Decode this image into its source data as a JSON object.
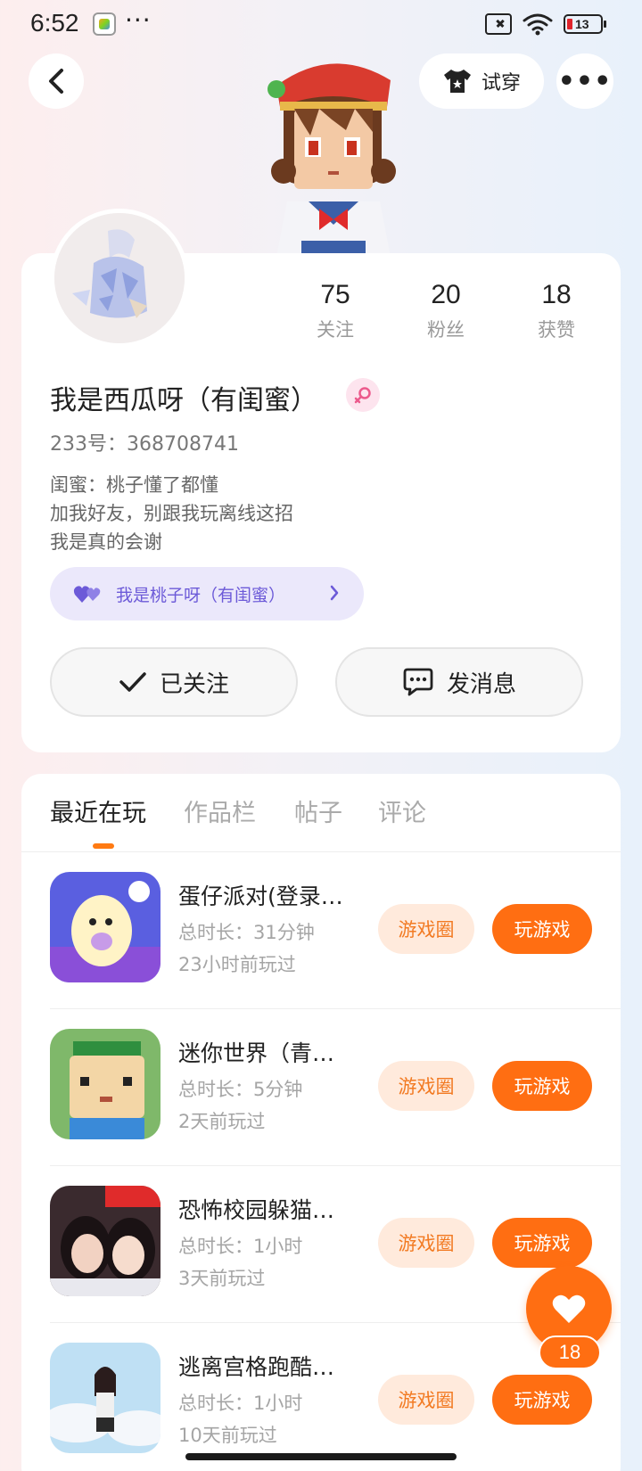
{
  "status_bar": {
    "time": "6:52",
    "dots": "···",
    "battery": "13"
  },
  "header": {
    "tryon_label": "试穿",
    "more_label": "•••"
  },
  "profile": {
    "stats": [
      {
        "value": "75",
        "label": "关注"
      },
      {
        "value": "20",
        "label": "粉丝"
      },
      {
        "value": "18",
        "label": "获赞"
      }
    ],
    "username": "我是西瓜呀（有闺蜜）",
    "user_id": "233号：368708741",
    "bio_lines": [
      "闺蜜：桃子懂了都懂",
      "加我好友，别跟我玩离线这招",
      "我是真的会谢"
    ],
    "bestie_label": "我是桃子呀（有闺蜜）",
    "follow_label": "已关注",
    "message_label": "发消息"
  },
  "tabs": [
    {
      "label": "最近在玩",
      "active": true
    },
    {
      "label": "作品栏",
      "active": false
    },
    {
      "label": "帖子",
      "active": false
    },
    {
      "label": "评论",
      "active": false
    }
  ],
  "games": [
    {
      "title": "蛋仔派对(登录…",
      "duration": "总时长：31分钟",
      "last_played": "23小时前玩过",
      "icon": "eggy-party-icon"
    },
    {
      "title": "迷你世界（青…",
      "duration": "总时长：5分钟",
      "last_played": "2天前玩过",
      "icon": "mini-world-icon"
    },
    {
      "title": "恐怖校园躲猫…",
      "duration": "总时长：1小时",
      "last_played": "3天前玩过",
      "icon": "horror-school-icon"
    },
    {
      "title": "逃离宫格跑酷…",
      "duration": "总时长：1小时",
      "last_played": "10天前玩过",
      "icon": "parkour-icon"
    }
  ],
  "game_actions": {
    "circle_label": "游戏圈",
    "play_label": "玩游戏"
  },
  "like": {
    "count": "18"
  },
  "colors": {
    "accent": "#ff6e12",
    "accent_light": "#ffeadc",
    "bestie_bg": "#ebe8fb",
    "bestie_text": "#6c5ad8"
  }
}
